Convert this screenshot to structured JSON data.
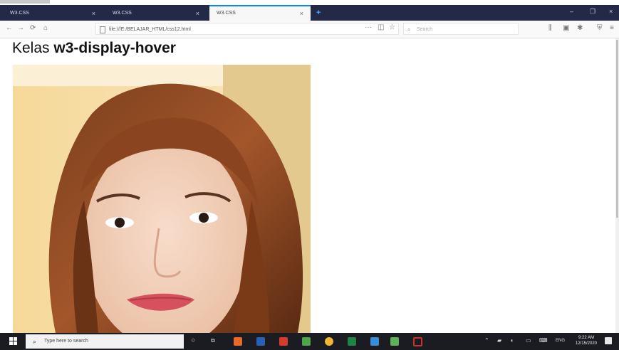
{
  "browser": {
    "tabs": [
      {
        "label": "W3.CSS",
        "active": false
      },
      {
        "label": "W3.CSS",
        "active": false
      },
      {
        "label": "W3.CSS",
        "active": true
      }
    ],
    "new_tab_glyph": "+",
    "window_controls": {
      "minimize": "–",
      "maximize": "❐",
      "close": "×"
    },
    "nav": {
      "back": "←",
      "forward": "→",
      "reload": "⟳",
      "home": "⌂"
    },
    "url": "file:///E:/BELAJAR_HTML/css12.html",
    "url_more": "···",
    "search_placeholder": "Search",
    "toolbar_icons": [
      "library-icon",
      "sidebar-icon",
      "extension-icon",
      "shield-icon",
      "menu-icon"
    ]
  },
  "page": {
    "heading_prefix": "Kelas",
    "heading_class": "w3-display-hover",
    "image_description": "portrait photo"
  },
  "taskbar": {
    "search_placeholder": "Type here to search",
    "app_icons": [
      "task-view",
      "file-explorer",
      "firefox",
      "word",
      "foxit",
      "notepad",
      "chrome",
      "excel",
      "paint",
      "notes",
      "snip"
    ],
    "clock_time": "9:22 AM",
    "clock_date": "12/15/2020",
    "lang": "ENG"
  },
  "colors": {
    "tabbar": "#222a48",
    "active_tab_accent": "#0a84ff",
    "taskbar": "#1b1c22"
  }
}
